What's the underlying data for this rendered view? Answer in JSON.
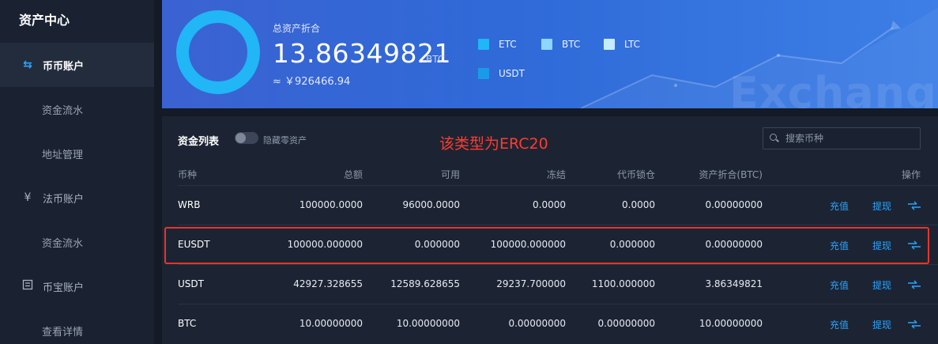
{
  "sidebar": {
    "title": "资产中心",
    "items": [
      {
        "label": "币币账户",
        "icon": "swap-arrows-icon",
        "type": "group",
        "active": true
      },
      {
        "label": "资金流水",
        "type": "sub"
      },
      {
        "label": "地址管理",
        "type": "sub"
      },
      {
        "label": "法币账户",
        "icon": "yen-icon",
        "type": "group"
      },
      {
        "label": "资金流水",
        "type": "sub"
      },
      {
        "label": "币宝账户",
        "icon": "vault-icon",
        "type": "group"
      },
      {
        "label": "查看详情",
        "type": "sub"
      }
    ]
  },
  "banner": {
    "label": "总资产折合",
    "value": "13.86349821",
    "unit": "BTC",
    "cny": "≈ ￥926466.94",
    "legend": [
      {
        "label": "ETC",
        "color": "#21b6f5"
      },
      {
        "label": "BTC",
        "color": "#8fd6ff"
      },
      {
        "label": "LTC",
        "color": "#c6ebff"
      },
      {
        "label": "USDT",
        "color": "#1a9be8"
      }
    ],
    "watermark": "Exchange"
  },
  "panel": {
    "title": "资金列表",
    "toggle_label": "隐藏零资产",
    "annotation": "该类型为ERC20",
    "search_placeholder": "搜索币种",
    "columns": [
      "币种",
      "总额",
      "可用",
      "冻结",
      "代币锁仓",
      "资产折合(BTC)",
      "操作"
    ],
    "rows": [
      {
        "coin": "WRB",
        "total": "100000.0000",
        "available": "96000.0000",
        "frozen": "0.0000",
        "locked": "0.0000",
        "btc": "0.00000000"
      },
      {
        "coin": "EUSDT",
        "total": "100000.000000",
        "available": "0.000000",
        "frozen": "100000.000000",
        "locked": "0.000000",
        "btc": "0.00000000"
      },
      {
        "coin": "USDT",
        "total": "42927.328655",
        "available": "12589.628655",
        "frozen": "29237.700000",
        "locked": "1100.000000",
        "btc": "3.86349821"
      },
      {
        "coin": "BTC",
        "total": "10.00000000",
        "available": "10.00000000",
        "frozen": "0.00000000",
        "locked": "0.00000000",
        "btc": "10.00000000"
      }
    ],
    "actions": {
      "deposit": "充值",
      "withdraw": "提现"
    }
  }
}
